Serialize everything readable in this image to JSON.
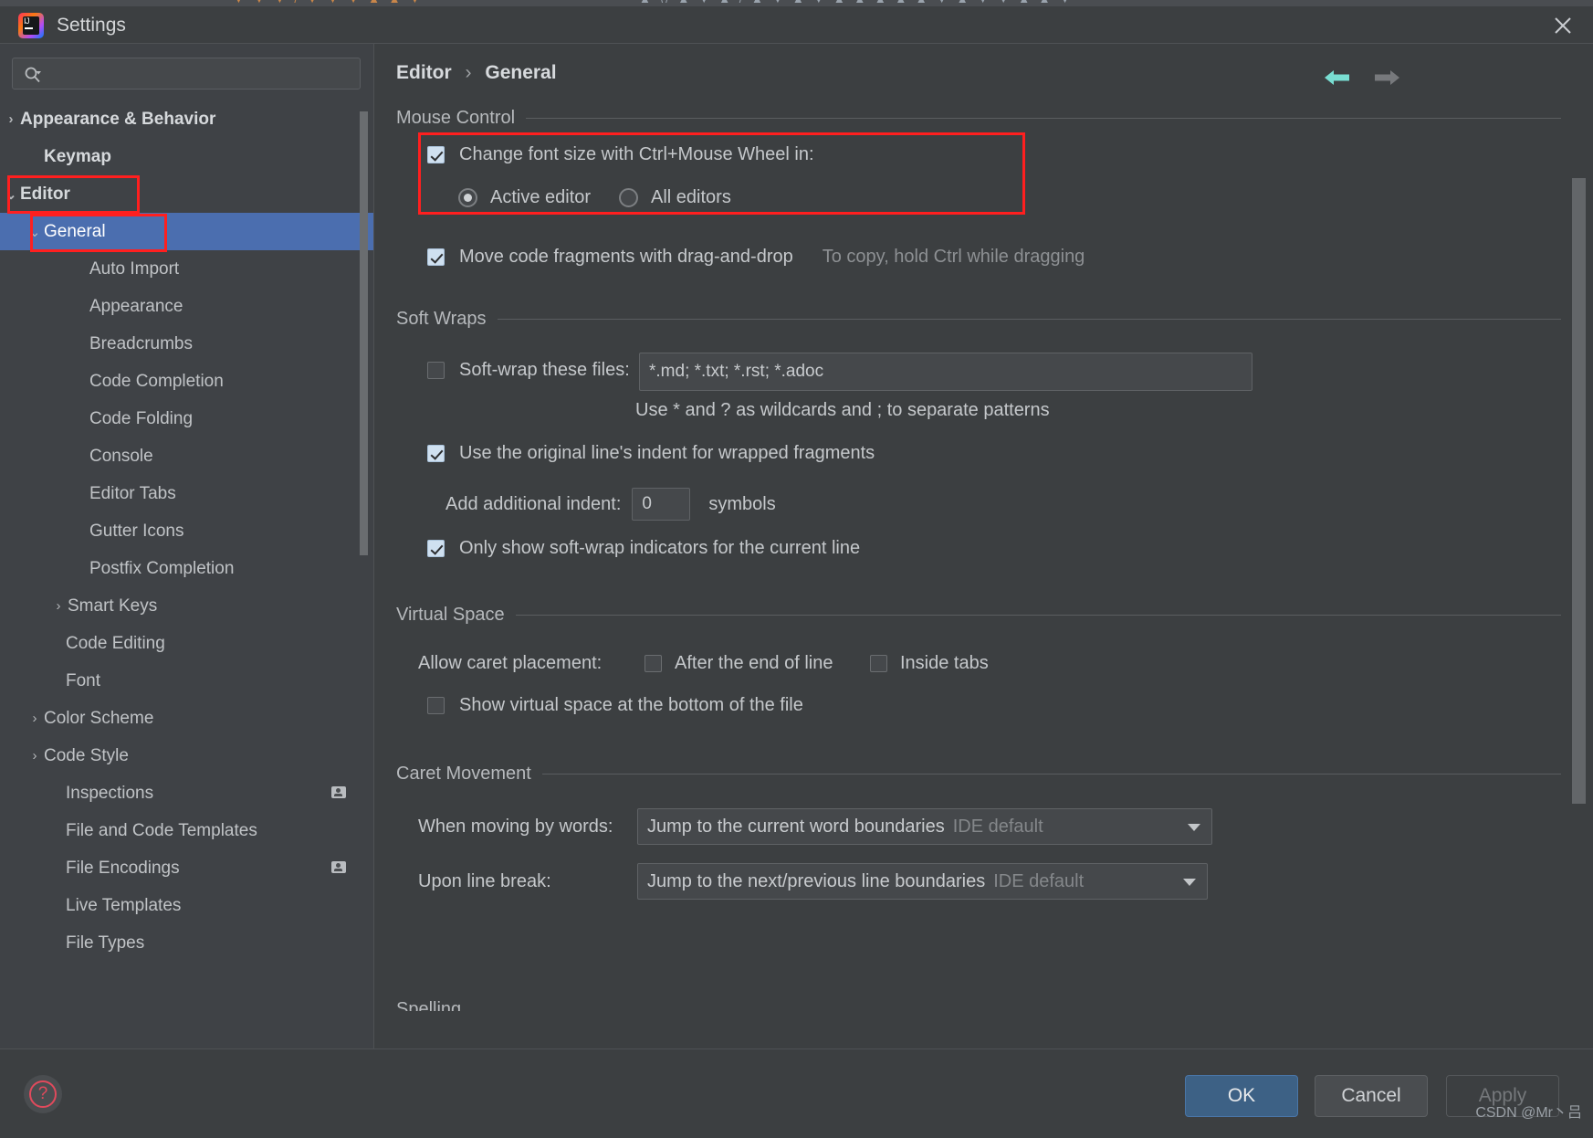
{
  "window": {
    "title": "Settings",
    "logo_text": "IJ",
    "close_icon": "close-icon"
  },
  "background_strip": {
    "glyphs_left": "▼ ▼ ▼ / ▼ ▼ ▼     ▲ ▲ ▼",
    "glyphs_right": "▲ \\/ ▲ ▼ ▲ / ▲     ▼ ▲ ▼ ▲     ▲ ▲ ▲ ▲ ▼ ▲ ▼ ▼ ▲ ▲ ▼"
  },
  "sidebar": {
    "search": {
      "value": "",
      "placeholder": "",
      "icon": "search-icon"
    },
    "scrollbar": "sidebar-scrollbar",
    "items": [
      {
        "label": "Appearance & Behavior",
        "twisty": "›",
        "indent": 22,
        "bold": true,
        "selected": false,
        "badge": false
      },
      {
        "label": "Keymap",
        "twisty": "",
        "indent": 48,
        "bold": true,
        "selected": false,
        "badge": false
      },
      {
        "label": "Editor",
        "twisty": "⌄",
        "indent": 22,
        "bold": true,
        "selected": false,
        "badge": false
      },
      {
        "label": "General",
        "twisty": "⌄",
        "indent": 48,
        "bold": false,
        "selected": true,
        "badge": false
      },
      {
        "label": "Auto Import",
        "twisty": "",
        "indent": 98,
        "bold": false,
        "selected": false,
        "badge": false
      },
      {
        "label": "Appearance",
        "twisty": "",
        "indent": 98,
        "bold": false,
        "selected": false,
        "badge": false
      },
      {
        "label": "Breadcrumbs",
        "twisty": "",
        "indent": 98,
        "bold": false,
        "selected": false,
        "badge": false
      },
      {
        "label": "Code Completion",
        "twisty": "",
        "indent": 98,
        "bold": false,
        "selected": false,
        "badge": false
      },
      {
        "label": "Code Folding",
        "twisty": "",
        "indent": 98,
        "bold": false,
        "selected": false,
        "badge": false
      },
      {
        "label": "Console",
        "twisty": "",
        "indent": 98,
        "bold": false,
        "selected": false,
        "badge": false
      },
      {
        "label": "Editor Tabs",
        "twisty": "",
        "indent": 98,
        "bold": false,
        "selected": false,
        "badge": false
      },
      {
        "label": "Gutter Icons",
        "twisty": "",
        "indent": 98,
        "bold": false,
        "selected": false,
        "badge": false
      },
      {
        "label": "Postfix Completion",
        "twisty": "",
        "indent": 98,
        "bold": false,
        "selected": false,
        "badge": false
      },
      {
        "label": "Smart Keys",
        "twisty": "›",
        "indent": 74,
        "bold": false,
        "selected": false,
        "badge": false
      },
      {
        "label": "Code Editing",
        "twisty": "",
        "indent": 72,
        "bold": false,
        "selected": false,
        "badge": false
      },
      {
        "label": "Font",
        "twisty": "",
        "indent": 72,
        "bold": false,
        "selected": false,
        "badge": false
      },
      {
        "label": "Color Scheme",
        "twisty": "›",
        "indent": 48,
        "bold": false,
        "selected": false,
        "badge": false
      },
      {
        "label": "Code Style",
        "twisty": "›",
        "indent": 48,
        "bold": false,
        "selected": false,
        "badge": false
      },
      {
        "label": "Inspections",
        "twisty": "",
        "indent": 72,
        "bold": false,
        "selected": false,
        "badge": true
      },
      {
        "label": "File and Code Templates",
        "twisty": "",
        "indent": 72,
        "bold": false,
        "selected": false,
        "badge": false
      },
      {
        "label": "File Encodings",
        "twisty": "",
        "indent": 72,
        "bold": false,
        "selected": false,
        "badge": true
      },
      {
        "label": "Live Templates",
        "twisty": "",
        "indent": 72,
        "bold": false,
        "selected": false,
        "badge": false
      },
      {
        "label": "File Types",
        "twisty": "",
        "indent": 72,
        "bold": false,
        "selected": false,
        "badge": false
      }
    ]
  },
  "content": {
    "breadcrumb": {
      "parent": "Editor",
      "separator": "›",
      "current": "General"
    },
    "nav": {
      "back_icon": "arrow-left-icon",
      "forward_icon": "arrow-right-icon",
      "back_color": "#79ded2",
      "forward_color": "#77797c"
    },
    "sections": {
      "mouse_control": {
        "title": "Mouse Control",
        "change_font_size": {
          "label": "Change font size with Ctrl+Mouse Wheel in:",
          "checked": true
        },
        "radios": [
          {
            "label": "Active editor",
            "checked": true
          },
          {
            "label": "All editors",
            "checked": false
          }
        ],
        "drag_and_drop": {
          "label": "Move code fragments with drag-and-drop",
          "checked": true,
          "hint": "To copy, hold Ctrl while dragging"
        }
      },
      "soft_wraps": {
        "title": "Soft Wraps",
        "soft_wrap_files": {
          "label": "Soft-wrap these files:",
          "checked": false,
          "value": "*.md; *.txt; *.rst; *.adoc"
        },
        "wildcard_hint": "Use * and ? as wildcards and ; to separate patterns",
        "original_indent": {
          "label": "Use the original line's indent for wrapped fragments",
          "checked": true
        },
        "additional_indent": {
          "label": "Add additional indent:",
          "value": "0",
          "unit": "symbols"
        },
        "only_current_line": {
          "label": "Only show soft-wrap indicators for the current line",
          "checked": true
        }
      },
      "virtual_space": {
        "title": "Virtual Space",
        "caret_placement_label": "Allow caret placement:",
        "after_end_of_line": {
          "label": "After the end of line",
          "checked": false
        },
        "inside_tabs": {
          "label": "Inside tabs",
          "checked": false
        },
        "show_virtual_space": {
          "label": "Show virtual space at the bottom of the file",
          "checked": false
        }
      },
      "caret_movement": {
        "title": "Caret Movement",
        "when_moving_by_words": {
          "label": "When moving by words:",
          "value": "Jump to the current word boundaries",
          "hint": "IDE default"
        },
        "upon_line_break": {
          "label": "Upon line break:",
          "value": "Jump to the next/previous line boundaries",
          "hint": "IDE default"
        }
      },
      "cutoff": {
        "title": "Spelling"
      }
    },
    "scrollbar": "content-scrollbar"
  },
  "footer": {
    "help_icon": "help-icon",
    "ok_label": "OK",
    "cancel_label": "Cancel",
    "apply_label": "Apply",
    "watermark": "CSDN @Mr丶吕"
  },
  "colors": {
    "selection": "#4b6eaf",
    "highlight_box": "#ff1f1f",
    "ok_button": "#3d6185",
    "accent_back_arrow": "#79ded2"
  }
}
